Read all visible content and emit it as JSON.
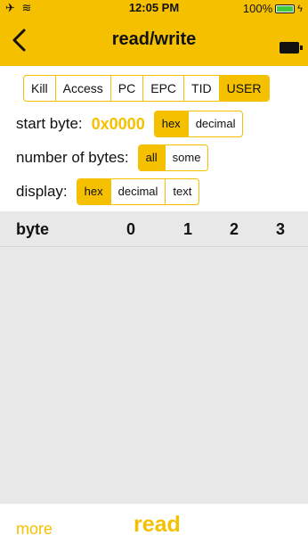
{
  "status_bar": {
    "signal_glyphs": "✈ ≋",
    "time": "12:05 PM",
    "battery_percent": "100%",
    "battery_level": 1.0,
    "charging_glyph": "ϟ"
  },
  "nav": {
    "title": "read/write",
    "back_icon": "chevron-left-icon",
    "battery_icon": "battery-icon"
  },
  "memory_tabs": [
    {
      "label": "Kill",
      "active": false
    },
    {
      "label": "Access",
      "active": false
    },
    {
      "label": "PC",
      "active": false
    },
    {
      "label": "EPC",
      "active": false
    },
    {
      "label": "TID",
      "active": false
    },
    {
      "label": "USER",
      "active": true
    }
  ],
  "start_byte": {
    "label": "start byte:",
    "value": "0x0000",
    "options": [
      {
        "label": "hex",
        "active": true
      },
      {
        "label": "decimal",
        "active": false
      }
    ]
  },
  "number_of_bytes": {
    "label": "number of bytes:",
    "options": [
      {
        "label": "all",
        "active": true
      },
      {
        "label": "some",
        "active": false
      }
    ]
  },
  "display": {
    "label": "display:",
    "options": [
      {
        "label": "hex",
        "active": true
      },
      {
        "label": "decimal",
        "active": false
      },
      {
        "label": "text",
        "active": false
      }
    ]
  },
  "table": {
    "headers": [
      "byte",
      "0",
      "1",
      "2",
      "3"
    ]
  },
  "footer": {
    "more_label": "more",
    "read_label": "read"
  },
  "colors": {
    "accent": "#f5c000",
    "table_bg": "#e8e8e8",
    "battery_green": "#3ecb3e"
  }
}
